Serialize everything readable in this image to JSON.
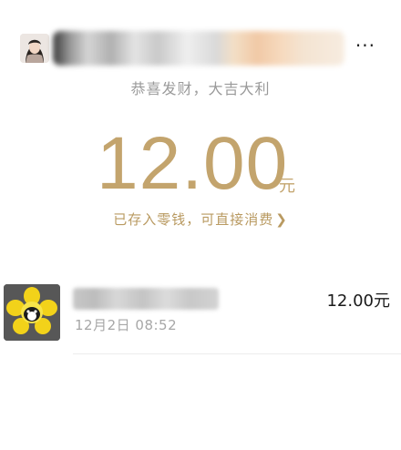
{
  "sender": {
    "avatar_icon": "user-avatar-icon",
    "wish": "恭喜发财，大吉大利"
  },
  "menu": {
    "more_label": "···",
    "more_icon": "more-icon"
  },
  "amount": {
    "value": "12.00",
    "unit": "元",
    "color": "#c3a46d"
  },
  "change_notice": {
    "text": "已存入零钱，可直接消费",
    "chevron": "❯",
    "chevron_icon": "chevron-right-icon"
  },
  "record": {
    "avatar_icon": "sunflower-avatar-icon",
    "time": "12月2日  08:52",
    "amount": "12.00元"
  }
}
